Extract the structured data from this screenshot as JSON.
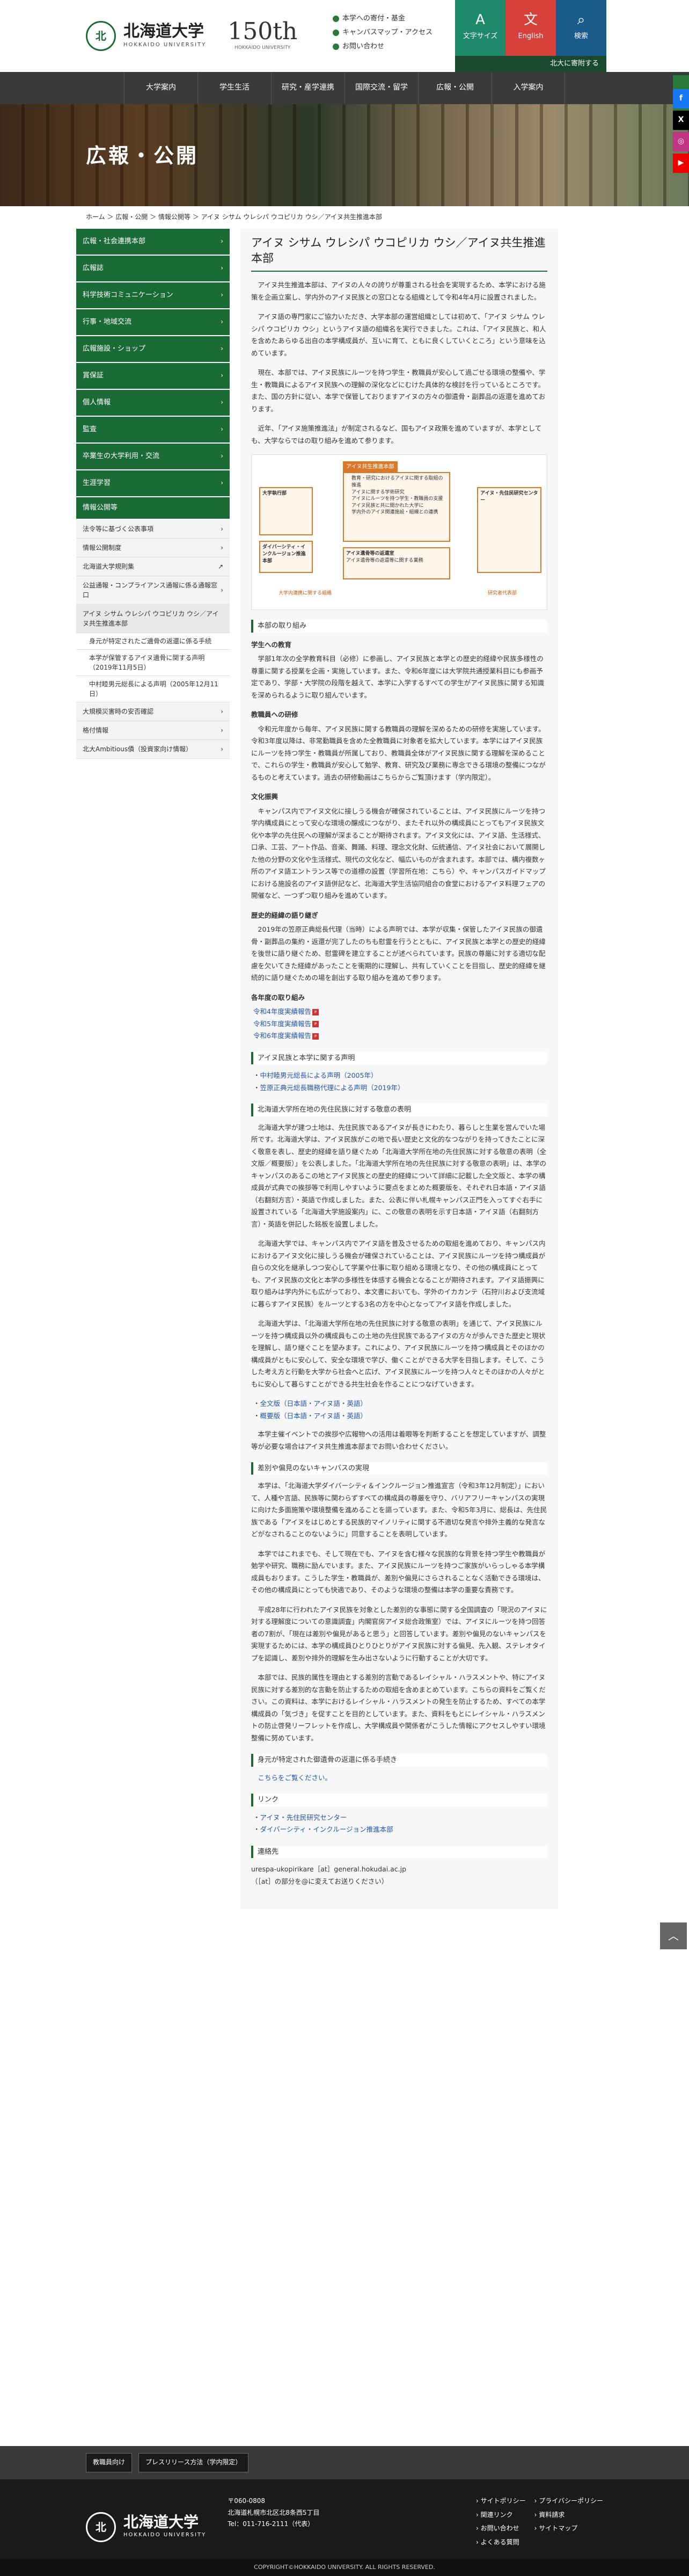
{
  "header": {
    "logo_jp": "北海道大学",
    "logo_en": "HOKKAIDO UNIVERSITY",
    "anniv_num": "150th",
    "anniv_sub": "HOKKAIDO UNIVERSITY",
    "quick": [
      "本学への寄付・基金",
      "キャンパスマップ・アクセス",
      "お問い合わせ"
    ],
    "util": [
      {
        "label": "文字サイズ",
        "icon": "A"
      },
      {
        "label": "English",
        "icon": "文"
      },
      {
        "label": "検索",
        "icon": "⌕"
      }
    ],
    "donate": "北大に寄附する"
  },
  "gnav": [
    "大学案内",
    "学生生活",
    "研究・産学連携",
    "国際交流・留学",
    "広報・公開",
    "入学案内"
  ],
  "hero_title": "広報・公開",
  "sns_tab": "SNS",
  "breadcrumb": "ホーム ＞ 広報・公開 ＞ 情報公開等 ＞ アイヌ シサム ウレシパ ウコピリカ ウシ／アイヌ共生推進本部",
  "side": {
    "heads": [
      "広報・社会連携本部",
      "広報誌",
      "科学技術コミュニケーション",
      "行事・地域交流",
      "広報施設・ショップ",
      "賞保証",
      "個人情報",
      "監査",
      "卒業生の大学利用・交流",
      "生涯学習"
    ],
    "active": "情報公開等",
    "subs": [
      "法令等に基づく公表事項",
      "情報公開制度",
      "北海道大学規則集",
      "公益通報・コンプライアンス通報に係る通報窓口"
    ],
    "current": "アイヌ シサム ウレシパ ウコピリカ ウシ／アイヌ共生推進本部",
    "current_subs": [
      "身元が特定されたご遺骨の返還に係る手続",
      "本学が保管するアイヌ遺骨に関する声明（2019年11月5日）",
      "中村睦男元総長による声明（2005年12月11日）"
    ],
    "after": [
      "大規模災害時の安否確認",
      "格付情報",
      "北大Ambitious債（投資家向け情報）"
    ]
  },
  "main": {
    "title": "アイヌ シサム ウレシパ ウコピリカ ウシ／アイヌ共生推進本部",
    "intro": [
      "アイヌ共生推進本部は、アイヌの人々の誇りが尊重される社会を実現するため、本学における施策を企画立案し、学内外のアイヌ民族との窓口となる組織として令和4年4月に設置されました。",
      "アイヌ語の専門家にご協力いただき、大学本部の運営組織としては初めて、「アイヌ シサム ウレシパ ウコピリカ ウシ」というアイヌ語の組織名を実行できました。これは、「アイヌ民族と、和人を含めたあらゆる出自の本学構成員が、互いに育て、ともに良くしていくところ」という意味を込めています。",
      "現在、本部では、アイヌ民族にルーツを持つ学生・教職員が安心して過ごせる環境の整備や、学生・教職員によるアイヌ民族への理解の深化などにむけた具体的な検討を行っているところです。また、国の方針に従い、本学で保管しておりますアイヌの方々の御遺骨・副葬品の返還を進めております。",
      "近年、「アイヌ施策推進法」が制定されるなど、国もアイヌ政策を進めていますが、本学としても、大学ならではの取り組みを進めて参ります。"
    ],
    "diagram": {
      "center_head": "アイヌ共生推進本部",
      "center_items": [
        "教育・研究におけるアイヌに関する取組の推進",
        "アイヌに関する学術研究",
        "アイヌにルーツを持つ学生・教職員の支援",
        "アイヌ民族と共に開かれた大学に",
        "学内外のアイヌ関連施設・組織との連携"
      ],
      "left_head": "大学執行部",
      "left_sub": "ダイバーシティ・インクルージョン推進本部",
      "right_head": "アイヌ・先住民研究センター",
      "bottom_head": "アイヌ遺骨等の返還室",
      "bottom_items": [
        "アイヌ遺骨等の返還等に関する業務"
      ],
      "label_left": "大学内連携に関する組織",
      "label_right": "研究者代表部"
    },
    "sec1": "本部の取り組み",
    "items": [
      {
        "h": "学生への教育",
        "t": "学部1年次の全学教育科目（必修）に参画し、アイヌ民族と本学との歴史的経緯や民族多様性の尊重に関する授業を企画・実施しています。また、令和6年度には大学院共通授業科目にも参画予定であり、学部・大学院の段階を越えて、本学に入学するすべての学生がアイヌ民族に関する知識を深められるように取り組んでいます。"
      },
      {
        "h": "教職員への研修",
        "t": "令和元年度から毎年、アイヌ民族に関する教職員の理解を深めるための研修を実施しています。令和3年度以降は、非常勤職員を含めた全教職員に対象者を拡大しています。本学にはアイヌ民族にルーツを持つ学生・教職員が所属しており、教職員全体がアイヌ民族に関する理解を深めることで、これらの学生・教職員が安心して勉学、教育、研究及び業務に専念できる環境の整備につながるものと考えています。過去の研修動画はこちらからご覧頂けます（学内限定）。"
      },
      {
        "h": "文化振興",
        "t": "キャンパス内でアイヌ文化に接しうる機会が確保されていることは、アイヌ民族にルーツを持つ学内構成員にとって安心な環境の醸成につながり、またそれ以外の構成員にとってもアイヌ民族文化や本学の先住民への理解が深まることが期待されます。アイヌ文化には、アイヌ語、生活様式、口承、工芸、アート作品、音楽、舞踊、料理、理念文化財、伝統通信、アイヌ社会において展開した他の分野の文化や生活様式、現代の文化など、幅広いものが含まれます。本部では、構内複数ヶ所のアイヌ語エントランス等での道標の設置（学習所在地：こちら）や、キャンパスガイドマップにおける施設名のアイヌ語併記など、北海道大学生活協同組合の食堂におけるアイヌ料理フェアの開催など、一つずつ取り組みを進めています。"
      },
      {
        "h": "歴史的経緯の語り継ぎ",
        "t": "2019年の笠原正典総長代理（当時）による声明では、本学が収集・保管したアイヌ民族の御遺骨・副葬品の集約・返還が完了したのちも慰霊を行うとともに、アイヌ民族と本学との歴史的経緯を後世に語り継ぐため、慰霊碑を建立することが述べられています。民族の尊厳に対する適切な配慮を欠いてきた経緯があったことを衝期的に理解し、共有していくことを目指し、歴史的経緯を継続的に語り継ぐための場を創出する取り組みを進めて参ります。"
      },
      {
        "h": "各年度の取り組み",
        "t": ""
      }
    ],
    "years": [
      "令和4年度実績報告",
      "令和5年度実績報告",
      "令和6年度実績報告"
    ],
    "sec2": "アイヌ民族と本学に関する声明",
    "stmts": [
      "中村睦男元総長による声明（2005年）",
      "笠原正典元総長職務代理による声明（2019年）"
    ],
    "sec3": "北海道大学所在地の先住民族に対する敬意の表明",
    "respect": [
      "北海道大学が建つ土地は、先住民族であるアイヌが長きにわたり、暮らしと生業を営んでいた場所です。北海道大学は、アイヌ民族がこの地で長い歴史と文化的なつながりを持ってきたことに深く敬意を表し、歴史的経緯を語り継ぐため「北海道大学所在地の先住民族に対する敬意の表明（全文版／概要版）」を公表しました。「北海道大学所在地の先住民族に対する敬意の表明」は、本学のキャンパスのあるこの地とアイヌ民族との歴史的経緯について詳細に記載した全文版と、本学の構成員が式典での挨拶等で利用しやすいように要点をまとめた概要版を、それぞれ日本語・アイヌ語（右翻刻方言）・英語で作成しました。また、公表に伴い札幌キャンパス正門を入ってすぐ右手に設置されている「北海道大学施設案内」に、この敬意の表明を示す日本語・アイヌ語（右翻刻方言）・英語を併記した銘板を設置しました。",
      "北海道大学では、キャンパス内でアイヌ語を普及させるための取組を進めており、キャンパス内におけるアイヌ文化に接しうる機会が確保されていることは、アイヌ民族にルーツを持つ構成員が自らの文化を継承しつつ安心して学業や仕事に取り組める環境となり、その他の構成員にとっても、アイヌ民族の文化と本学の多様性を体感する機会となることが期待されます。アイヌ語振興に取り組みは学内外にも広がっており、本文書においても、学外のイカカンテ（石狩川および支流域に暮らすアイヌ民族）をルーツとする3名の方を中心となってアイヌ語を作成しました。",
      "北海道大学は、「北海道大学所在地の先住民族に対する敬意の表明」を通じて、アイヌ民族にルーツを持つ構成員以外の構成員もこの土地の先住民族であるアイヌの方々が歩んできた歴史と現状を理解し、語り継ぐことを望みます。これにより、アイヌ民族にルーツを持つ構成員とそのほかの構成員がともに安心して、安全な環境で学び、働くことができる大学を目指します。そして、こうした考え方と行動を大学から社会へと広げ、アイヌ民族にルーツを持つ人々とそのほかの人々がともに安心して暮らすことができる共生社会を作ることにつなげていきます。"
    ],
    "respect_links": [
      "全文版（日本語・アイヌ語・英語）",
      "概要版（日本語・アイヌ語・英語）"
    ],
    "respect_note": "本学主催イベントでの挨拶や広報物への活用は着眼等を判断することを想定していますが、調整等が必要な場合はアイヌ共生推進本部までお問い合わせください。",
    "sec4": "差別や偏見のないキャンパスの実現",
    "disc": [
      "本学は、「北海道大学ダイバーシティ＆インクルージョン推進宣言（令和3年12月制定）」において、人種や言語、民族等に関わらずすべての構成員の尊厳を守り、バリアフリーキャンパスの実現に向けた多面施策や環境整備を進めることを謳っています。また、令和5年3月に、総長は、先住民族である「アイヌをはじめとする民族的マイノリティに関する不適切な発言や排外主義的な発言などがなされることのないように」同意することを表明しています。",
      "本学ではこれまでも、そして現在でも、アイヌを含む様々な民族的な背景を持つ学生や教職員が勉学や研究、職務に励んでいます。また、アイヌ民族にルーツを持つご家族がいらっしゃる本学構成員もおります。こうした学生・教職員が、差別や偏見にさらされることなく活動できる環境は、その他の構成員にとっても快適であり、そのような環境の整備は本学の重要な責務です。",
      "平成28年に行われたアイヌ民族を対象とした差別的な事態に関する全国調査の「現況のアイヌに対する理解度についての意識調査」内閣官房アイヌ総合政策室）では、アイヌにルーツを持つ回答者の7割が、「現在は差別や偏見があると思う」と回答しています。差別や偏見のないキャンパスを実現するためには、本学の構成員ひとりひとりがアイヌ民族に対する偏見、先入観、ステレオタイプを認識し、差別や排外的理解を生み出さないように行動することが大切です。",
      "本部では、民族的属性を理由とする差別的言動であるレイシャル・ハラスメントや、特にアイヌ民族に対する差別的な言動を防止するための取組を含めまとめています。こちらの資料をご覧ください。この資料は、本学におけるレイシャル・ハラスメントの発生を防止するため、すべての本学構成員の「気づき」を促すことを目的としています。また、資料をもとにレイシャル・ハラスメントの防止啓発リーフレットを作成し、大学構成員や関係者がこうした情報にアクセスしやすい環境整備に努めています。"
    ],
    "sec5": "身元が特定された御遺骨の返還に係る手続き",
    "sec5_text": "こちらをご覧ください。",
    "sec6": "リンク",
    "links": [
      "アイヌ・先住民研究センター",
      "ダイバーシティ・インクルージョン推進本部"
    ],
    "sec7": "連絡先",
    "contact": [
      "urespa-ukopirikare［at］general.hokudai.ac.jp",
      "（［at］の部分を@に変えてお送りください）"
    ]
  },
  "footer": {
    "btns": [
      "教職員向け",
      "プレスリリース方法（学内限定）"
    ],
    "logo_jp": "北海道大学",
    "logo_en": "HOKKAIDO UNIVERSITY",
    "addr": [
      "〒060-0808",
      "北海道札幌市北区北8条西5丁目",
      "Tel：011-716-2111（代表）"
    ],
    "links": [
      "サイトポリシー",
      "プライバシーポリシー",
      "関連リンク",
      "資料請求",
      "お問い合わせ",
      "サイトマップ",
      "よくある質問"
    ],
    "copy": "COPYRIGHT©HOKKAIDO UNIVERSITY. ALL RIGHTS RESERVED."
  }
}
